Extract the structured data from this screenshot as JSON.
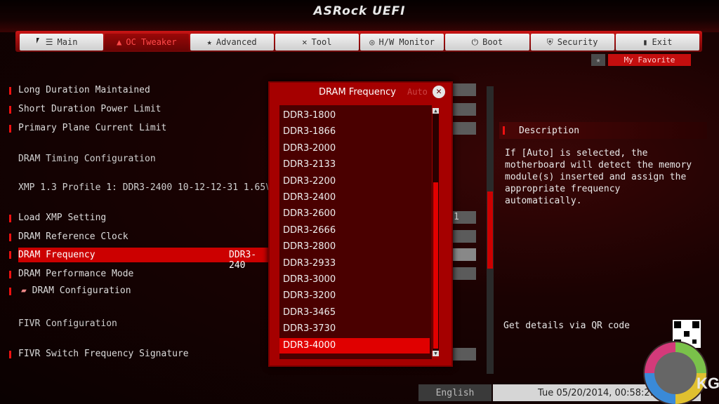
{
  "header": {
    "logo": "ASRock UEFI"
  },
  "tabs": [
    {
      "label": "Main",
      "icon": "☰"
    },
    {
      "label": "OC Tweaker",
      "icon": "▲"
    },
    {
      "label": "Advanced",
      "icon": "★"
    },
    {
      "label": "Tool",
      "icon": "✕"
    },
    {
      "label": "H/W Monitor",
      "icon": "◎"
    },
    {
      "label": "Boot",
      "icon": "⏻"
    },
    {
      "label": "Security",
      "icon": "⛨"
    },
    {
      "label": "Exit",
      "icon": "▮"
    }
  ],
  "favorite": {
    "label": "My Favorite",
    "star": "★"
  },
  "settings": {
    "long_duration": "Long Duration Maintained",
    "short_duration": "Short Duration Power Limit",
    "primary_plane": "Primary Plane Current Limit",
    "dram_timing": "DRAM Timing Configuration",
    "xmp_profile": "XMP 1.3 Profile 1: DDR3-2400 10-12-12-31 1.65V",
    "load_xmp": "Load XMP Setting",
    "load_xmp_val": "1",
    "dram_ref_clock": "DRAM Reference Clock",
    "dram_frequency": "DRAM Frequency",
    "dram_frequency_val": "DDR3-240",
    "dram_perf_mode": "DRAM Performance Mode",
    "dram_config": "DRAM Configuration",
    "fivr_config": "FIVR Configuration",
    "fivr_switch": "FIVR Switch Frequency Signature"
  },
  "popup": {
    "title": "DRAM Frequency",
    "current": "Auto",
    "close": "✕",
    "items": [
      "DDR3-1800",
      "DDR3-1866",
      "DDR3-2000",
      "DDR3-2133",
      "DDR3-2200",
      "DDR3-2400",
      "DDR3-2600",
      "DDR3-2666",
      "DDR3-2800",
      "DDR3-2933",
      "DDR3-3000",
      "DDR3-3200",
      "DDR3-3465",
      "DDR3-3730",
      "DDR3-4000"
    ],
    "selected": "DDR3-4000"
  },
  "description": {
    "heading": "Description",
    "text": "If [Auto] is selected, the motherboard will detect the memory module(s) inserted and assign the appropriate frequency automatically.",
    "qr_label": "Get details via QR code"
  },
  "footer": {
    "language": "English",
    "datetime": "Tue 05/20/2014, 00:58:29"
  },
  "watermark": {
    "text": "KG"
  },
  "colors": {
    "accent": "#cc0000",
    "panel": "#a50000"
  }
}
